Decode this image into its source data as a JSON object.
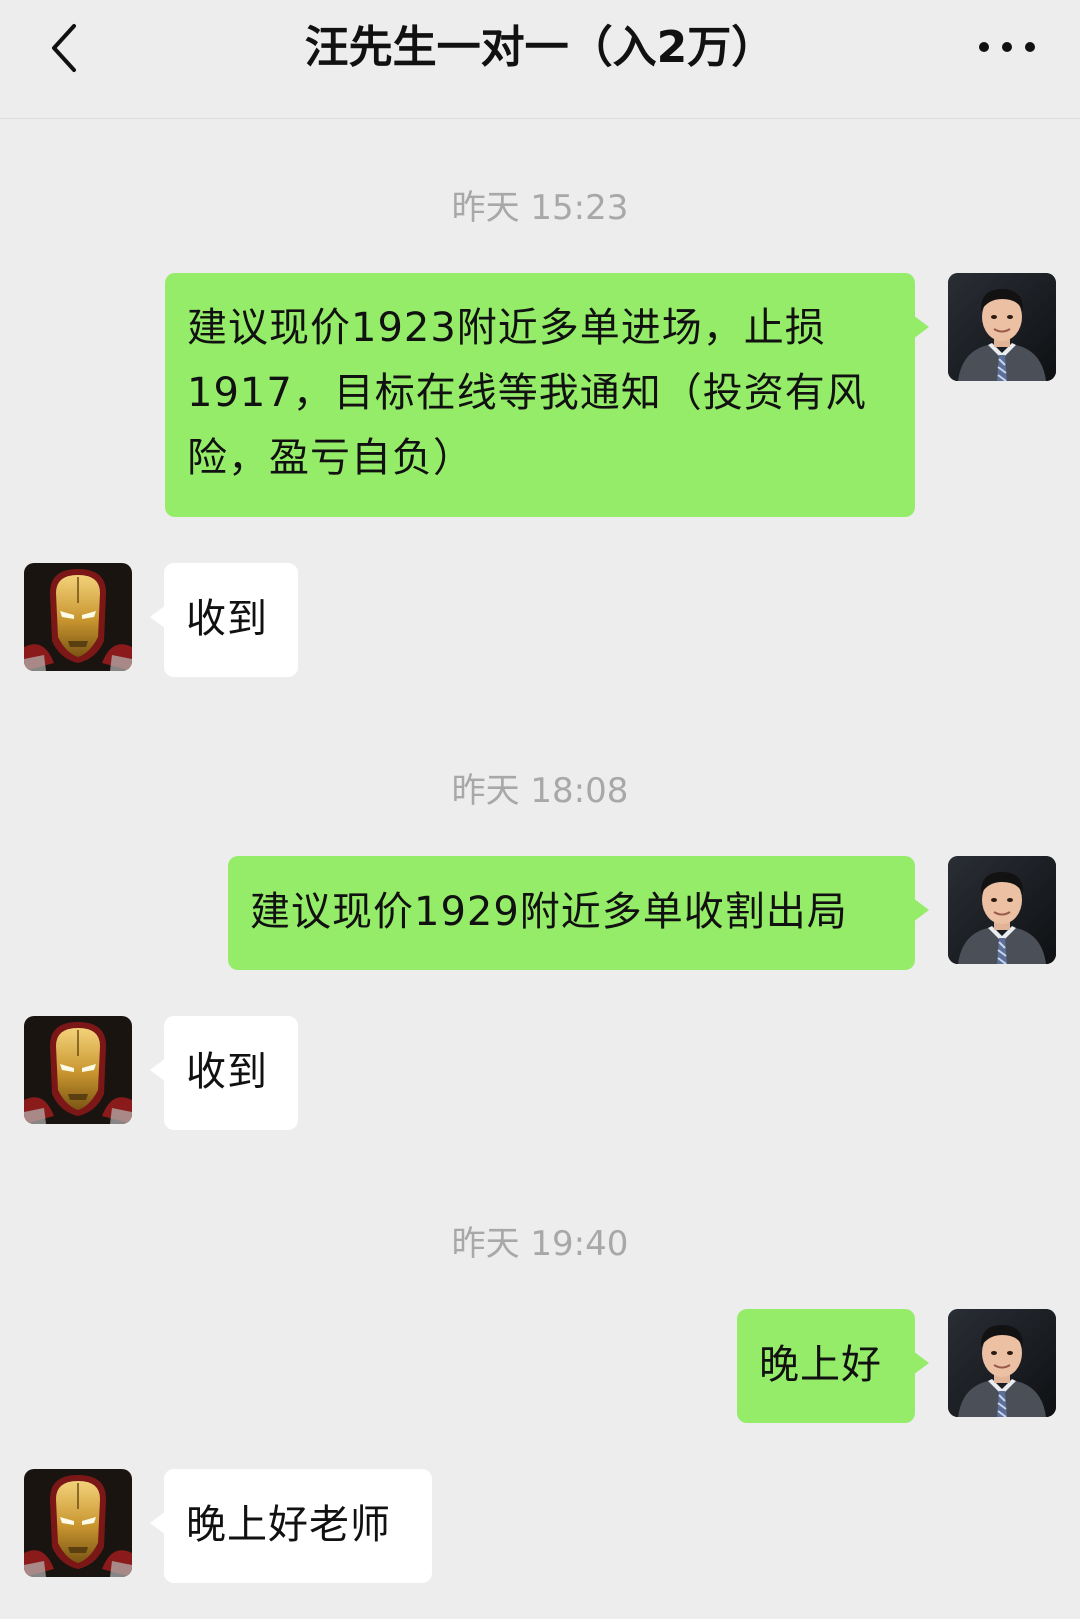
{
  "header": {
    "title": "汪先生一对一（入2万）",
    "back_icon": "chevron-left-icon",
    "more_icon": "more-dots-icon"
  },
  "colors": {
    "background": "#ededed",
    "outgoing_bubble": "#95ec69",
    "incoming_bubble": "#ffffff",
    "timestamp_text": "#a8a8a8"
  },
  "messages": [
    {
      "type": "timestamp",
      "text": "昨天 15:23"
    },
    {
      "type": "outgoing",
      "sender_avatar": "man-in-suit-avatar",
      "text": "建议现价1923附近多单进场，止损1917，目标在线等我通知（投资有风险，盈亏自负）"
    },
    {
      "type": "incoming",
      "sender_avatar": "iron-man-avatar",
      "text": "收到"
    },
    {
      "type": "timestamp",
      "text": "昨天 18:08"
    },
    {
      "type": "outgoing",
      "sender_avatar": "man-in-suit-avatar",
      "text": "建议现价1929附近多单收割出局"
    },
    {
      "type": "incoming",
      "sender_avatar": "iron-man-avatar",
      "text": "收到"
    },
    {
      "type": "timestamp",
      "text": "昨天 19:40"
    },
    {
      "type": "outgoing",
      "sender_avatar": "man-in-suit-avatar",
      "text": "晚上好"
    },
    {
      "type": "incoming",
      "sender_avatar": "iron-man-avatar",
      "text": "晚上好老师"
    }
  ]
}
